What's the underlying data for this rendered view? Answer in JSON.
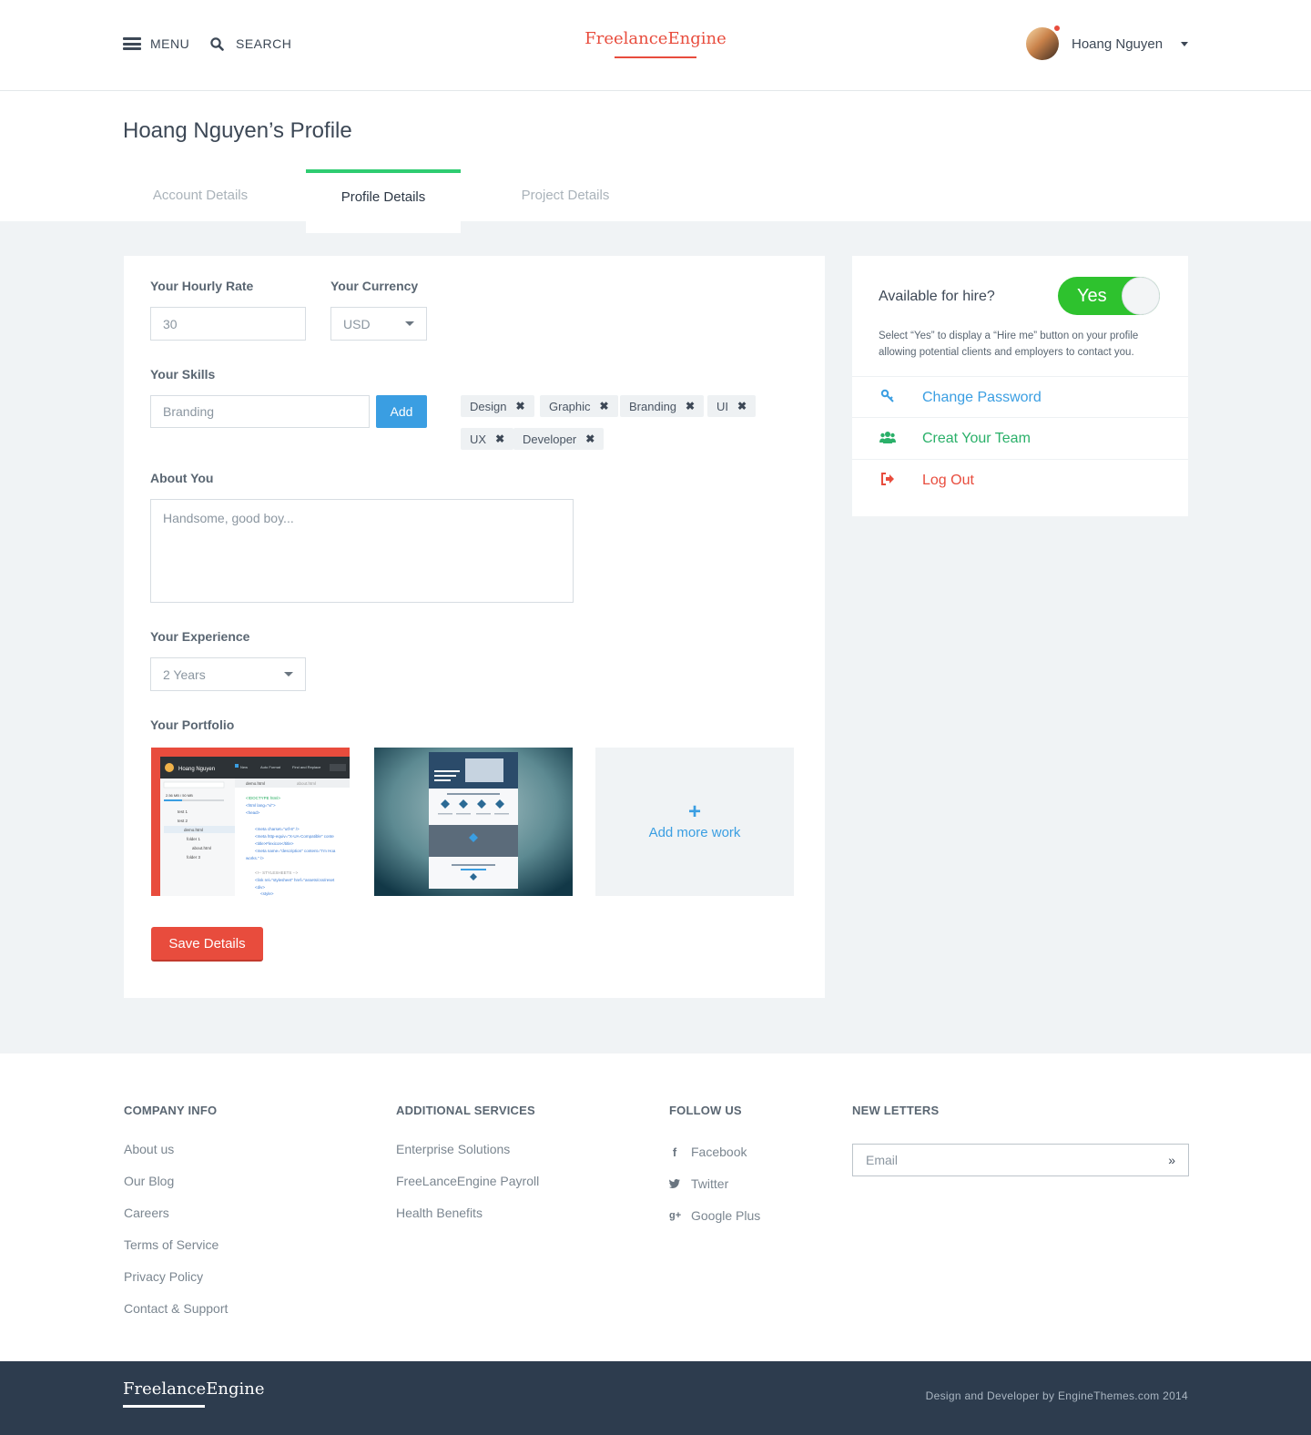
{
  "header": {
    "menu_label": "MENU",
    "search_label": "SEARCH",
    "logo": "FreelanceEngine",
    "user_name": "Hoang Nguyen"
  },
  "page": {
    "title": "Hoang Nguyen’s Profile",
    "tabs": [
      {
        "label": "Account Details",
        "active": false
      },
      {
        "label": "Profile Details",
        "active": true
      },
      {
        "label": "Project Details",
        "active": false
      }
    ]
  },
  "form": {
    "hourly_rate_label": "Your Hourly Rate",
    "hourly_rate_value": "30",
    "currency_label": "Your Currency",
    "currency_value": "USD",
    "skills_label": "Your Skills",
    "skills_input_value": "Branding",
    "add_button": "Add",
    "skills": [
      "Design",
      "Graphic",
      "Branding",
      "UI",
      "UX",
      "Developer"
    ],
    "remove_glyph": "✖",
    "about_label": "About You",
    "about_value": "Handsome, good boy...",
    "experience_label": "Your Experience",
    "experience_value": "2 Years",
    "portfolio_label": "Your Portfolio",
    "add_more_plus": "+",
    "add_more_label": "Add more work",
    "save_button": "Save Details"
  },
  "portfolio_thumb_1": {
    "user": "Hoang Nguyen",
    "new": "New",
    "auto_format": "Auto Format",
    "find_replace": "Find and Replace",
    "file": "demo.html",
    "file_tab_2": "about.html",
    "usage": "2.56 MB / 50 MB",
    "tree": [
      "test 1",
      "test 2",
      "demo.html",
      "folder 1",
      "about.html",
      "folder 3"
    ],
    "code": [
      "<!DOCTYPE html>",
      "<html lang=\"vi\">",
      "<head>",
      "<meta charset=\"utf-8\" />",
      "<meta http-equiv=\"X-UA-Compatible\" conte",
      "<title>Flexicon</title>",
      "<meta name=\"description\" content=\"I'm Hoa",
      "works.\" />",
      "<!-- STYLESHEETS -->",
      "<link rel=\"stylesheet\" href=\"assets/css/reset",
      "<div>",
      "<style>"
    ]
  },
  "sidebar": {
    "available_label": "Available for hire?",
    "toggle_label": "Yes",
    "toggle_on": true,
    "note": "Select “Yes” to display a “Hire me” button on your profile allowing potential clients and employers to contact you.",
    "links": [
      {
        "label": "Change Password",
        "icon": "key-icon",
        "color": "#3a9ee2"
      },
      {
        "label": "Creat Your Team",
        "icon": "users-icon",
        "color": "#2ab069"
      },
      {
        "label": "Log Out",
        "icon": "sign-out-icon",
        "color": "#e84c3d"
      }
    ]
  },
  "footer": {
    "company_heading": "COMPANY INFO",
    "company_links": [
      "About us",
      "Our Blog",
      "Careers",
      "Terms of Service",
      "Privacy Policy",
      "Contact & Support"
    ],
    "services_heading": "ADDITIONAL SERVICES",
    "services_links": [
      "Enterprise Solutions",
      "FreeLanceEngine Payroll",
      "Health Benefits"
    ],
    "follow_heading": "FOLLOW US",
    "social": [
      {
        "label": "Facebook",
        "icon": "facebook-icon"
      },
      {
        "label": "Twitter",
        "icon": "twitter-icon"
      },
      {
        "label": "Google Plus",
        "icon": "google-plus-icon"
      }
    ],
    "newsletter_heading": "NEW LETTERS",
    "email_placeholder": "Email",
    "bottom_logo": "FreelanceEngine",
    "credit": "Design and Developer by EngineThemes.com 2014"
  },
  "colors": {
    "accent_red": "#e84c3d",
    "accent_green": "#2ecc71",
    "accent_blue": "#3a9ee2",
    "footer_dark": "#2d3c4e"
  }
}
